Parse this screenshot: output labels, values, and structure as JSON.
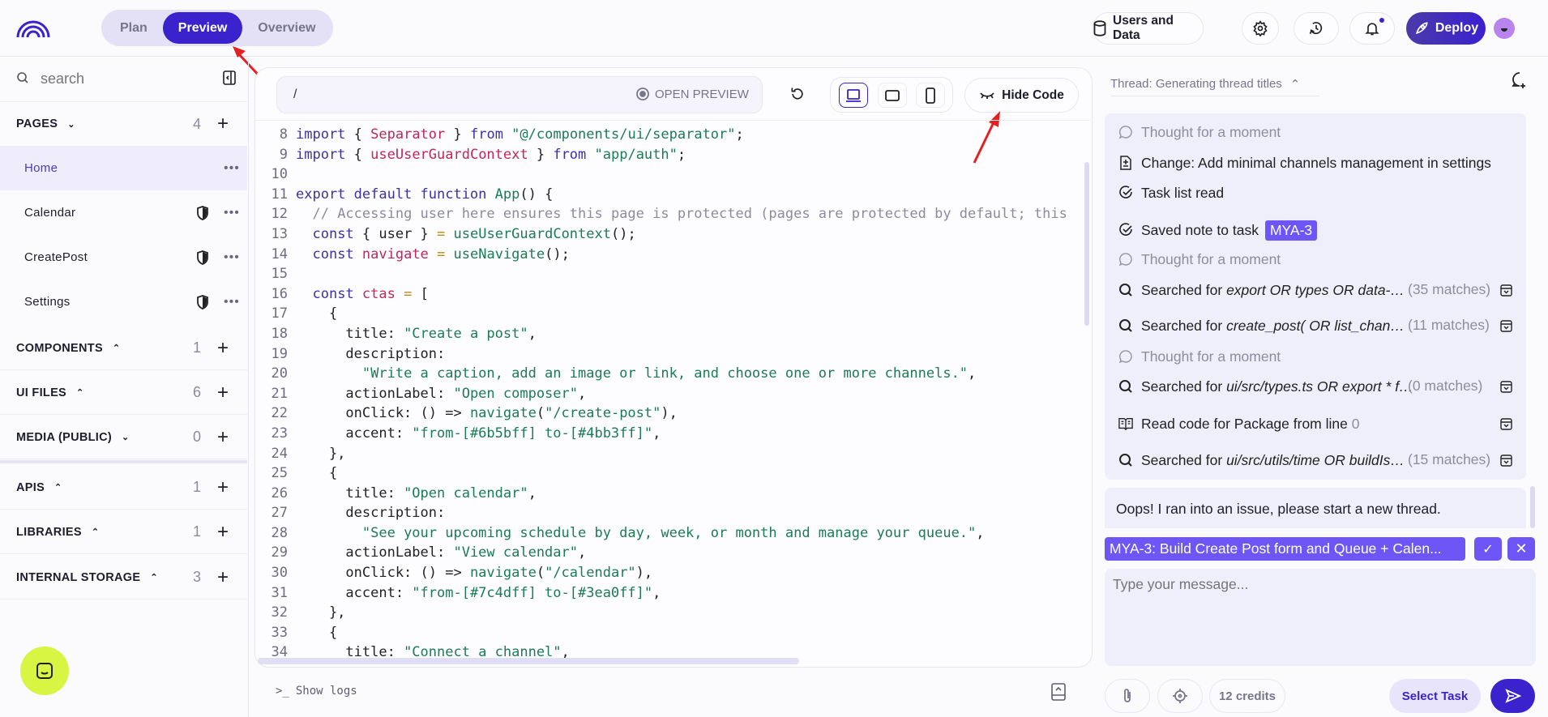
{
  "header": {
    "tabs": [
      {
        "label": "Plan"
      },
      {
        "label": "Preview",
        "active": true
      },
      {
        "label": "Overview"
      }
    ],
    "users_and_data": "Users and Data",
    "deploy": "Deploy"
  },
  "sidebar": {
    "search_placeholder": "search",
    "pages": {
      "label": "PAGES",
      "count": "4",
      "items": [
        {
          "label": "Home",
          "selected": true,
          "protected": false
        },
        {
          "label": "Calendar",
          "protected": true
        },
        {
          "label": "CreatePost",
          "protected": true
        },
        {
          "label": "Settings",
          "protected": true
        }
      ]
    },
    "sections": [
      {
        "label": "COMPONENTS",
        "count": "1",
        "chev": "up"
      },
      {
        "label": "UI FILES",
        "count": "6",
        "chev": "up"
      },
      {
        "label": "MEDIA (PUBLIC)",
        "count": "0",
        "chev": "down"
      },
      {
        "label": "APIS",
        "count": "1",
        "chev": "up"
      },
      {
        "label": "LIBRARIES",
        "count": "1",
        "chev": "up"
      },
      {
        "label": "INTERNAL STORAGE",
        "count": "3",
        "chev": "up"
      }
    ]
  },
  "preview": {
    "url": "/",
    "open_preview": "OPEN PREVIEW",
    "hide_code": "Hide Code",
    "show_logs": "Show logs",
    "code": [
      {
        "n": "8",
        "t": [
          [
            "kw",
            "import"
          ],
          [
            "p",
            " { "
          ],
          [
            "id",
            "Separator"
          ],
          [
            "p",
            " } "
          ],
          [
            "kw",
            "from"
          ],
          [
            "str",
            " \"@/components/ui/separator\""
          ],
          [
            "p",
            ";"
          ]
        ]
      },
      {
        "n": "9",
        "t": [
          [
            "kw",
            "import"
          ],
          [
            "p",
            " { "
          ],
          [
            "id",
            "useUserGuardContext"
          ],
          [
            "p",
            " } "
          ],
          [
            "kw",
            "from"
          ],
          [
            "str",
            " \"app/auth\""
          ],
          [
            "p",
            ";"
          ]
        ]
      },
      {
        "n": "10",
        "t": []
      },
      {
        "n": "11",
        "t": [
          [
            "kw",
            "export default function "
          ],
          [
            "fn",
            "App"
          ],
          [
            "p",
            "() {"
          ]
        ]
      },
      {
        "n": "12",
        "t": [
          [
            "p",
            "  "
          ],
          [
            "cm",
            "// Accessing user here ensures this page is protected (pages are protected by default; this"
          ]
        ]
      },
      {
        "n": "13",
        "t": [
          [
            "p",
            "  "
          ],
          [
            "kw",
            "const"
          ],
          [
            "p",
            " { user } "
          ],
          [
            "op",
            "="
          ],
          [
            "fn",
            " useUserGuardContext"
          ],
          [
            "p",
            "();"
          ]
        ]
      },
      {
        "n": "14",
        "t": [
          [
            "p",
            "  "
          ],
          [
            "kw",
            "const "
          ],
          [
            "id",
            "navigate"
          ],
          [
            "op",
            " ="
          ],
          [
            "fn",
            " useNavigate"
          ],
          [
            "p",
            "();"
          ]
        ]
      },
      {
        "n": "15",
        "t": []
      },
      {
        "n": "16",
        "t": [
          [
            "p",
            "  "
          ],
          [
            "kw",
            "const "
          ],
          [
            "id",
            "ctas"
          ],
          [
            "op",
            " ="
          ],
          [
            "p",
            " ["
          ]
        ]
      },
      {
        "n": "17",
        "t": [
          [
            "p",
            "    {"
          ]
        ]
      },
      {
        "n": "18",
        "t": [
          [
            "p",
            "      title: "
          ],
          [
            "str",
            "\"Create a post\""
          ],
          [
            "p",
            ","
          ]
        ]
      },
      {
        "n": "19",
        "t": [
          [
            "p",
            "      description:"
          ]
        ]
      },
      {
        "n": "20",
        "t": [
          [
            "p",
            "        "
          ],
          [
            "str",
            "\"Write a caption, add an image or link, and choose one or more channels.\""
          ],
          [
            "p",
            ","
          ]
        ]
      },
      {
        "n": "21",
        "t": [
          [
            "p",
            "      actionLabel: "
          ],
          [
            "str",
            "\"Open composer\""
          ],
          [
            "p",
            ","
          ]
        ]
      },
      {
        "n": "22",
        "t": [
          [
            "p",
            "      onClick: () => "
          ],
          [
            "fn",
            "navigate"
          ],
          [
            "p",
            "("
          ],
          [
            "str",
            "\"/create-post\""
          ],
          [
            "p",
            "),"
          ]
        ]
      },
      {
        "n": "23",
        "t": [
          [
            "p",
            "      accent: "
          ],
          [
            "str",
            "\"from-[#6b5bff] to-[#4bb3ff]\""
          ],
          [
            "p",
            ","
          ]
        ]
      },
      {
        "n": "24",
        "t": [
          [
            "p",
            "    },"
          ]
        ]
      },
      {
        "n": "25",
        "t": [
          [
            "p",
            "    {"
          ]
        ]
      },
      {
        "n": "26",
        "t": [
          [
            "p",
            "      title: "
          ],
          [
            "str",
            "\"Open calendar\""
          ],
          [
            "p",
            ","
          ]
        ]
      },
      {
        "n": "27",
        "t": [
          [
            "p",
            "      description:"
          ]
        ]
      },
      {
        "n": "28",
        "t": [
          [
            "p",
            "        "
          ],
          [
            "str",
            "\"See your upcoming schedule by day, week, or month and manage your queue.\""
          ],
          [
            "p",
            ","
          ]
        ]
      },
      {
        "n": "29",
        "t": [
          [
            "p",
            "      actionLabel: "
          ],
          [
            "str",
            "\"View calendar\""
          ],
          [
            "p",
            ","
          ]
        ]
      },
      {
        "n": "30",
        "t": [
          [
            "p",
            "      onClick: () => "
          ],
          [
            "fn",
            "navigate"
          ],
          [
            "p",
            "("
          ],
          [
            "str",
            "\"/calendar\""
          ],
          [
            "p",
            "),"
          ]
        ]
      },
      {
        "n": "31",
        "t": [
          [
            "p",
            "      accent: "
          ],
          [
            "str",
            "\"from-[#7c4dff] to-[#3ea0ff]\""
          ],
          [
            "p",
            ","
          ]
        ]
      },
      {
        "n": "32",
        "t": [
          [
            "p",
            "    },"
          ]
        ]
      },
      {
        "n": "33",
        "t": [
          [
            "p",
            "    {"
          ]
        ]
      },
      {
        "n": "34",
        "t": [
          [
            "p",
            "      title: "
          ],
          [
            "str",
            "\"Connect a channel\""
          ],
          [
            "p",
            ","
          ]
        ]
      }
    ]
  },
  "chat": {
    "thread_title": "Thread: Generating thread titles",
    "items": [
      {
        "icon": "thought",
        "text": "Thought for a moment",
        "muted": true
      },
      {
        "icon": "change",
        "text": "Change: Add minimal channels management in settings"
      },
      {
        "icon": "check",
        "text": "Task list read"
      },
      {
        "icon": "check",
        "text": "Saved note to task",
        "badge": "MYA-3"
      },
      {
        "icon": "thought",
        "text": "Thought for a moment",
        "muted": true
      },
      {
        "icon": "search",
        "text": "Searched for",
        "query": "export OR types OR data-…",
        "matches": "(35 matches)"
      },
      {
        "icon": "search",
        "text": "Searched for",
        "query": "create_post( OR list_chan…",
        "matches": "(11 matches)"
      },
      {
        "icon": "thought",
        "text": "Thought for a moment",
        "muted": true
      },
      {
        "icon": "search",
        "text": "Searched for",
        "query": "ui/src/types.ts OR export * f…",
        "matches": "(0 matches)"
      },
      {
        "icon": "book",
        "text": "Read code for Package from line",
        "suffix": "0",
        "expand": true
      },
      {
        "icon": "search",
        "text": "Searched for",
        "query": "ui/src/utils/time OR buildIs…",
        "matches": "(15 matches)"
      }
    ],
    "error": "Oops! I ran into an issue, please start a new thread.",
    "task_chip": "MYA-3: Build Create Post form and Queue + Calen...",
    "input_placeholder": "Type your message...",
    "credits": "12 credits",
    "select_task": "Select Task"
  },
  "colors": {
    "primary": "#3a22cc",
    "chip": "#6e56f6",
    "lime": "#d7f542"
  }
}
